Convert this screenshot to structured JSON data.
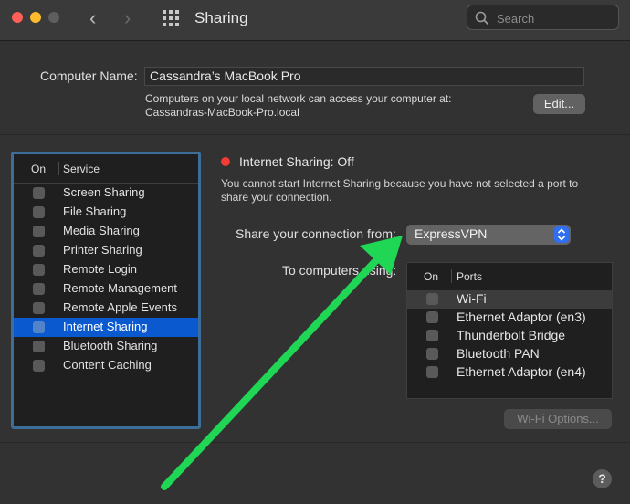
{
  "window": {
    "title": "Sharing"
  },
  "search": {
    "placeholder": "Search"
  },
  "computer_name": {
    "label": "Computer Name:",
    "value": "Cassandra’s MacBook Pro",
    "desc_line1": "Computers on your local network can access your computer at:",
    "desc_line2": "Cassandras-MacBook-Pro.local",
    "edit_label": "Edit..."
  },
  "services": {
    "header_on": "On",
    "header_service": "Service",
    "items": [
      {
        "label": "Screen Sharing",
        "checked": false
      },
      {
        "label": "File Sharing",
        "checked": false
      },
      {
        "label": "Media Sharing",
        "checked": false
      },
      {
        "label": "Printer Sharing",
        "checked": false
      },
      {
        "label": "Remote Login",
        "checked": false
      },
      {
        "label": "Remote Management",
        "checked": false
      },
      {
        "label": "Remote Apple Events",
        "checked": false
      },
      {
        "label": "Internet Sharing",
        "checked": false,
        "selected": true
      },
      {
        "label": "Bluetooth Sharing",
        "checked": false
      },
      {
        "label": "Content Caching",
        "checked": false
      }
    ]
  },
  "detail": {
    "status": "Internet Sharing: Off",
    "status_color": "#f23c34",
    "desc_line1": "You cannot start Internet Sharing because you have not selected a port to",
    "desc_line2": "share your connection.",
    "share_from_label": "Share your connection from:",
    "share_from_value": "ExpressVPN",
    "to_computers_label": "To computers using:",
    "ports_header_on": "On",
    "ports_header_ports": "Ports",
    "ports": [
      {
        "label": "Wi-Fi",
        "checked": false,
        "selected": true
      },
      {
        "label": "Ethernet Adaptor (en3)",
        "checked": false
      },
      {
        "label": "Thunderbolt Bridge",
        "checked": false
      },
      {
        "label": "Bluetooth PAN",
        "checked": false
      },
      {
        "label": "Ethernet Adaptor (en4)",
        "checked": false
      }
    ],
    "wifi_options_label": "Wi-Fi Options..."
  },
  "help": {
    "label": "?"
  },
  "annotation": {
    "arrow_color": "#1fd655"
  }
}
